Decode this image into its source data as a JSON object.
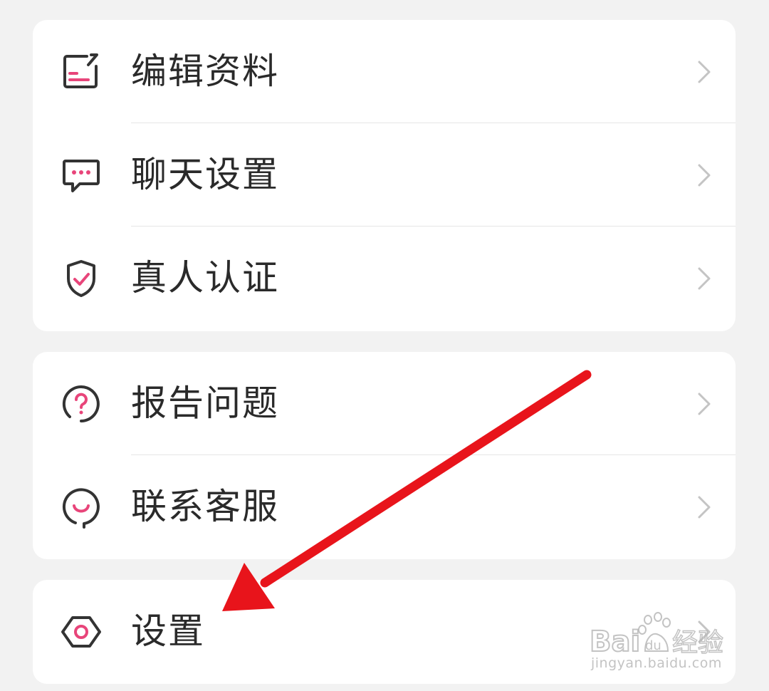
{
  "colors": {
    "background": "#f2f2f2",
    "card": "#ffffff",
    "text": "#2a2a2a",
    "icon_stroke": "#333333",
    "accent_pink": "#e8457a",
    "chevron": "#c4c4c4",
    "annotation_arrow": "#e8141b"
  },
  "menu": {
    "group1": [
      {
        "label": "编辑资料",
        "icon": "edit-profile-icon"
      },
      {
        "label": "聊天设置",
        "icon": "chat-bubble-icon"
      },
      {
        "label": "真人认证",
        "icon": "shield-check-icon"
      }
    ],
    "group2": [
      {
        "label": "报告问题",
        "icon": "question-circle-icon"
      },
      {
        "label": "联系客服",
        "icon": "customer-service-icon"
      }
    ],
    "group3": [
      {
        "label": "设置",
        "icon": "settings-hexagon-icon"
      }
    ]
  },
  "annotation": {
    "type": "red-arrow",
    "points_to": "设置"
  },
  "watermark": {
    "logo_text": "Bai du 经验",
    "url": "jingyan.baidu.com"
  }
}
